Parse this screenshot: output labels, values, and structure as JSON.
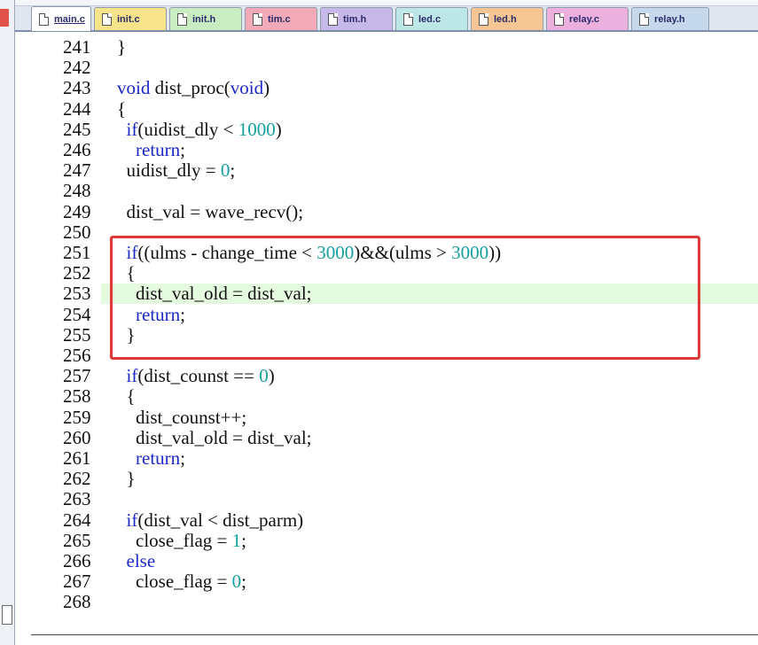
{
  "tabs": [
    {
      "label": "main.c",
      "color": "#ffffff",
      "active": true
    },
    {
      "label": "init.c",
      "color": "#f6e38a"
    },
    {
      "label": "init.h",
      "color": "#c9ecc2"
    },
    {
      "label": "tim.c",
      "color": "#f2a9b8"
    },
    {
      "label": "tim.h",
      "color": "#c7b8ea"
    },
    {
      "label": "led.c",
      "color": "#bde6e6"
    },
    {
      "label": "led.h",
      "color": "#f5c693"
    },
    {
      "label": "relay.c",
      "color": "#ebb0dd"
    },
    {
      "label": "relay.h",
      "color": "#c6d9ec"
    }
  ],
  "code_lines": [
    {
      "n": "241",
      "parts": [
        [
          "}",
          ""
        ]
      ]
    },
    {
      "n": "242",
      "parts": []
    },
    {
      "n": "243",
      "parts": [
        [
          "void",
          "kw"
        ],
        [
          " dist_proc(",
          ""
        ],
        [
          "void",
          "kw"
        ],
        [
          ")",
          ""
        ]
      ]
    },
    {
      "n": "244",
      "parts": [
        [
          "{",
          ""
        ]
      ]
    },
    {
      "n": "245",
      "parts": [
        [
          "  ",
          ""
        ],
        [
          "if",
          "kw"
        ],
        [
          "(uidist_dly < ",
          ""
        ],
        [
          "1000",
          "num"
        ],
        [
          ")",
          ""
        ]
      ]
    },
    {
      "n": "246",
      "parts": [
        [
          "    ",
          ""
        ],
        [
          "return",
          "kw"
        ],
        [
          ";",
          ""
        ]
      ]
    },
    {
      "n": "247",
      "parts": [
        [
          "  uidist_dly = ",
          ""
        ],
        [
          "0",
          "num"
        ],
        [
          ";",
          ""
        ]
      ]
    },
    {
      "n": "248",
      "parts": []
    },
    {
      "n": "249",
      "parts": [
        [
          "  dist_val = wave_recv();",
          ""
        ]
      ]
    },
    {
      "n": "250",
      "parts": []
    },
    {
      "n": "251",
      "parts": [
        [
          "  ",
          ""
        ],
        [
          "if",
          "kw"
        ],
        [
          "((ulms - change_time < ",
          ""
        ],
        [
          "3000",
          "num"
        ],
        [
          ")&&(ulms > ",
          ""
        ],
        [
          "3000",
          "num"
        ],
        [
          "))",
          ""
        ]
      ]
    },
    {
      "n": "252",
      "parts": [
        [
          "  {",
          ""
        ]
      ]
    },
    {
      "n": "253",
      "parts": [
        [
          "    dist_val_old = dist_val;",
          ""
        ]
      ],
      "highlight": true
    },
    {
      "n": "254",
      "parts": [
        [
          "    ",
          ""
        ],
        [
          "return",
          "kw"
        ],
        [
          ";",
          ""
        ]
      ]
    },
    {
      "n": "255",
      "parts": [
        [
          "  }",
          ""
        ]
      ]
    },
    {
      "n": "256",
      "parts": []
    },
    {
      "n": "257",
      "parts": [
        [
          "  ",
          ""
        ],
        [
          "if",
          "kw"
        ],
        [
          "(dist_counst == ",
          ""
        ],
        [
          "0",
          "num"
        ],
        [
          ")",
          ""
        ]
      ]
    },
    {
      "n": "258",
      "parts": [
        [
          "  {",
          ""
        ]
      ]
    },
    {
      "n": "259",
      "parts": [
        [
          "    dist_counst++;",
          ""
        ]
      ]
    },
    {
      "n": "260",
      "parts": [
        [
          "    dist_val_old = dist_val;",
          ""
        ]
      ]
    },
    {
      "n": "261",
      "parts": [
        [
          "    ",
          ""
        ],
        [
          "return",
          "kw"
        ],
        [
          ";",
          ""
        ]
      ]
    },
    {
      "n": "262",
      "parts": [
        [
          "  }",
          ""
        ]
      ]
    },
    {
      "n": "263",
      "parts": []
    },
    {
      "n": "264",
      "parts": [
        [
          "  ",
          ""
        ],
        [
          "if",
          "kw"
        ],
        [
          "(dist_val < dist_parm)",
          ""
        ]
      ]
    },
    {
      "n": "265",
      "parts": [
        [
          "    close_flag = ",
          ""
        ],
        [
          "1",
          "num"
        ],
        [
          ";",
          ""
        ]
      ]
    },
    {
      "n": "266",
      "parts": [
        [
          "  ",
          ""
        ],
        [
          "else",
          "kw"
        ]
      ]
    },
    {
      "n": "267",
      "parts": [
        [
          "    close_flag = ",
          ""
        ],
        [
          "0",
          "num"
        ],
        [
          ";",
          ""
        ]
      ]
    },
    {
      "n": "268",
      "parts": []
    }
  ],
  "colors": {
    "keyword": "#1c28c8",
    "number": "#14a0a0",
    "annotation_box": "#e23838",
    "current_line": "#e5fbe0"
  }
}
